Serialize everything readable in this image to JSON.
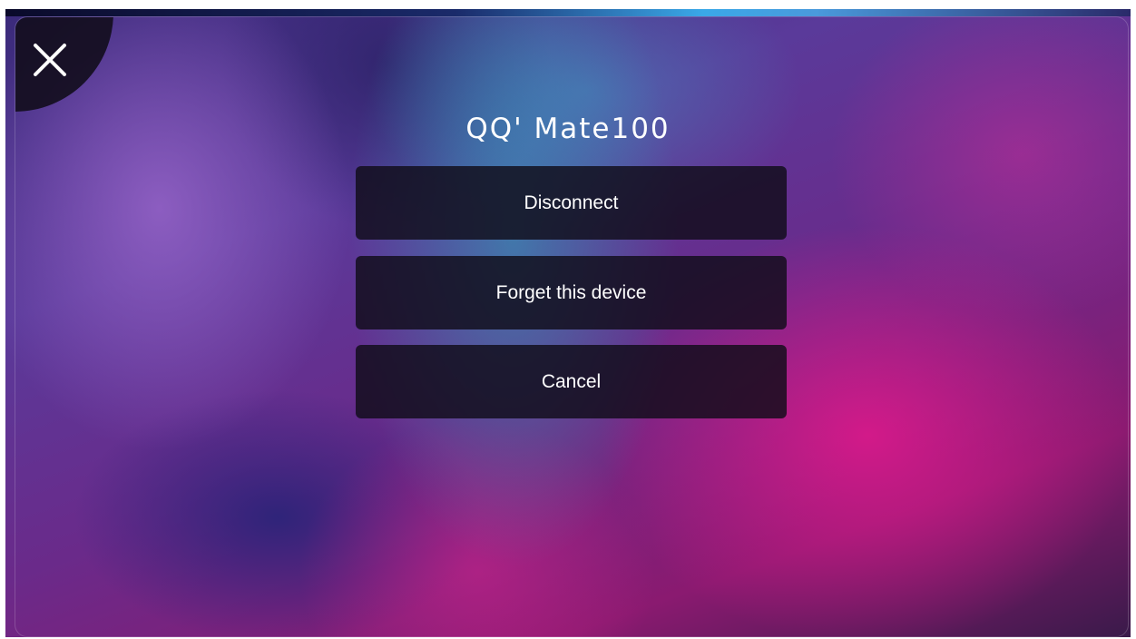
{
  "dialog": {
    "title": "QQ' Mate100",
    "close_icon": "close-icon"
  },
  "actions": {
    "disconnect_label": "Disconnect",
    "forget_label": "Forget this device",
    "cancel_label": "Cancel"
  },
  "colors": {
    "button_background": "#100c18",
    "text": "#ffffff",
    "corner_background": "#140e1e"
  }
}
